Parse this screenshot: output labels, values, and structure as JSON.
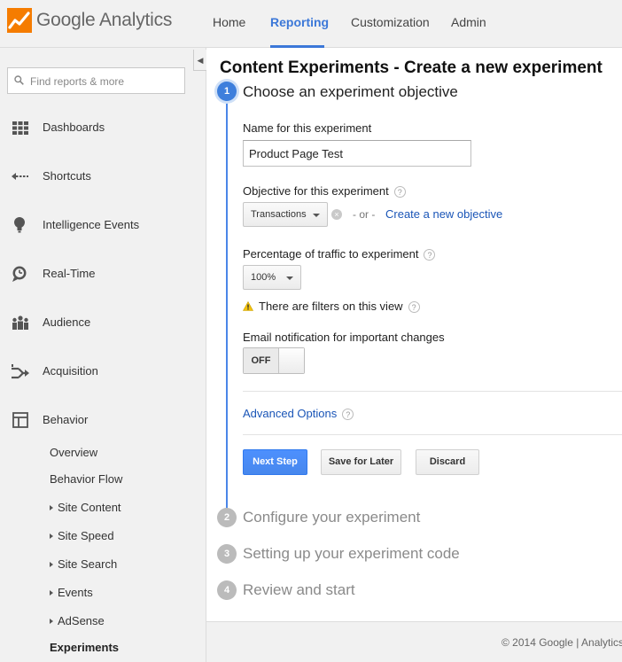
{
  "app": {
    "logo_text": "Google Analytics"
  },
  "nav": {
    "items": [
      {
        "label": "Home"
      },
      {
        "label": "Reporting"
      },
      {
        "label": "Customization"
      },
      {
        "label": "Admin"
      }
    ],
    "active": "Reporting"
  },
  "sidebar": {
    "collapse_glyph": "◀",
    "search_placeholder": "Find reports & more",
    "items": [
      {
        "label": "Dashboards",
        "icon": "grid-icon"
      },
      {
        "label": "Shortcuts",
        "icon": "shortcut-arrow-icon"
      },
      {
        "label": "Intelligence Events",
        "icon": "lightbulb-icon"
      },
      {
        "label": "Real-Time",
        "icon": "realtime-clock-icon"
      },
      {
        "label": "Audience",
        "icon": "people-icon"
      },
      {
        "label": "Acquisition",
        "icon": "acquisition-arrows-icon"
      },
      {
        "label": "Behavior",
        "icon": "behavior-layout-icon"
      }
    ],
    "behavior_sub": [
      {
        "label": "Overview"
      },
      {
        "label": "Behavior Flow"
      },
      {
        "label": "Site Content"
      },
      {
        "label": "Site Speed"
      },
      {
        "label": "Site Search"
      },
      {
        "label": "Events"
      },
      {
        "label": "AdSense"
      },
      {
        "label": "Experiments"
      }
    ]
  },
  "page": {
    "title": "Content Experiments - Create a new experiment"
  },
  "steps": [
    {
      "number": "1",
      "title": "Choose an experiment objective"
    },
    {
      "number": "2",
      "title": "Configure your experiment"
    },
    {
      "number": "3",
      "title": "Setting up your experiment code"
    },
    {
      "number": "4",
      "title": "Review and start"
    }
  ],
  "form": {
    "name_label": "Name for this experiment",
    "name_value": "Product Page Test",
    "objective_label": "Objective for this experiment",
    "objective_value": "Transactions",
    "or_text": "- or -",
    "create_objective_link": "Create a new objective",
    "traffic_label": "Percentage of traffic to experiment",
    "traffic_value": "100%",
    "filter_warning": "There are filters on this view",
    "email_label": "Email notification for important changes",
    "email_toggle": "OFF",
    "advanced_link": "Advanced Options",
    "help_glyph": "?",
    "clear_glyph": "×"
  },
  "buttons": {
    "next": "Next Step",
    "save": "Save for Later",
    "discard": "Discard"
  },
  "footer": {
    "text": "© 2014 Google | Analytics"
  },
  "colors": {
    "accent": "#3c78d8",
    "link": "#1a55b7",
    "primary_button": "#4d90fe",
    "warning": "#f4c20d"
  }
}
